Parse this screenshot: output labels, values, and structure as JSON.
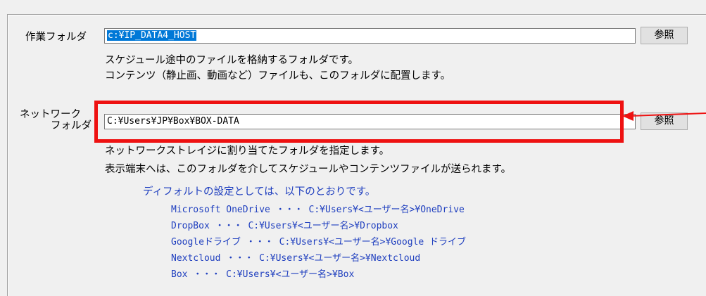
{
  "work_folder": {
    "label": "作業フォルダ",
    "value": "c:¥IP_DATA4_HOST",
    "browse": "参照",
    "desc1": "スケジュール途中のファイルを格納するフォルダです。",
    "desc2": "コンテンツ（静止画、動画など）ファイルも、このフォルダに配置します。"
  },
  "network_folder": {
    "label1": "ネットワーク",
    "label2": "フォルダ",
    "value": "C:¥Users¥JP¥Box¥BOX-DATA",
    "browse": "参照",
    "desc1": "ネットワークストレイジに割り当てたフォルダを指定します。",
    "desc2": "表示端末へは、このフォルダを介してスケジュールやコンテンツファイルが送られます。"
  },
  "defaults": {
    "heading": "ディフォルトの設定としては、以下のとおりです。",
    "items": [
      "Microsoft OneDrive ・・・ C:¥Users¥<ユーザー名>¥OneDrive",
      "DropBox ・・・ C:¥Users¥<ユーザー名>¥Dropbox",
      "Googleドライブ ・・・ C:¥Users¥<ユーザー名>¥Google ドライブ",
      "Nextcloud ・・・ C:¥Users¥<ユーザー名>¥Nextcloud",
      "Box ・・・ C:¥Users¥<ユーザー名>¥Box"
    ]
  },
  "colors": {
    "highlight": "#ee1111",
    "info_text": "#1f3fbf",
    "selection": "#0078d7"
  }
}
